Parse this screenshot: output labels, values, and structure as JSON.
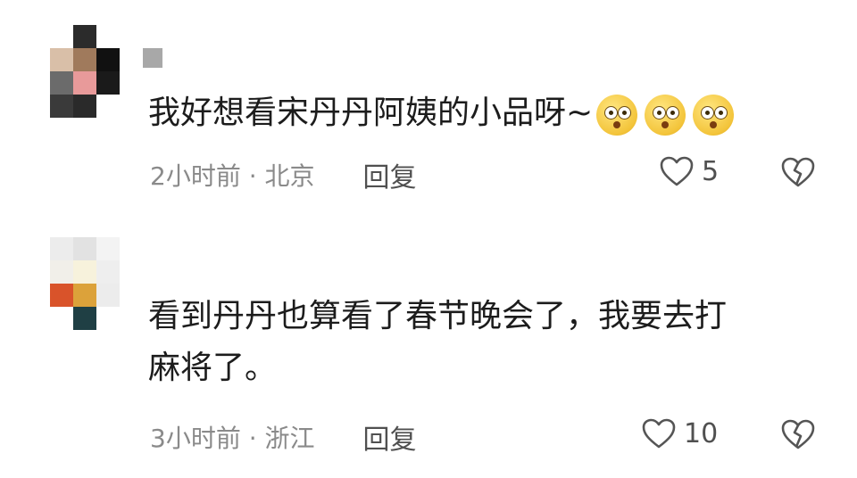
{
  "comments": [
    {
      "text_lines": [
        "我好想看宋丹丹阿姨的小品呀~"
      ],
      "emojis": [
        "shocked-emoji",
        "shocked-emoji",
        "shocked-emoji"
      ],
      "meta": "2小时前 · 北京",
      "reply_label": "回复",
      "likes": "5",
      "avatar_colors": [
        "#ffffff",
        "#2b2b2b",
        "#ffffff",
        "#d9bfa8",
        "#a07a5c",
        "#111111",
        "#6b6b6b",
        "#e89a9a",
        "#1a1a1a",
        "#3a3a3a",
        "#2a2a2a",
        "#ffffff"
      ]
    },
    {
      "text_lines": [
        "看到丹丹也算看了春节晚会了，我要去打",
        "麻将了。"
      ],
      "emojis": [],
      "meta": "3小时前 · 浙江",
      "reply_label": "回复",
      "likes": "10",
      "avatar_colors": [
        "#ececec",
        "#e2e2e2",
        "#f3f3f3",
        "#f1efe9",
        "#f7f2dc",
        "#eeeeee",
        "#d9532a",
        "#dca23a",
        "#ececec",
        "#ffffff",
        "#1f3f44",
        "#ffffff"
      ]
    }
  ],
  "icons": {
    "like": "heart-outline-icon",
    "dislike": "broken-heart-icon"
  }
}
